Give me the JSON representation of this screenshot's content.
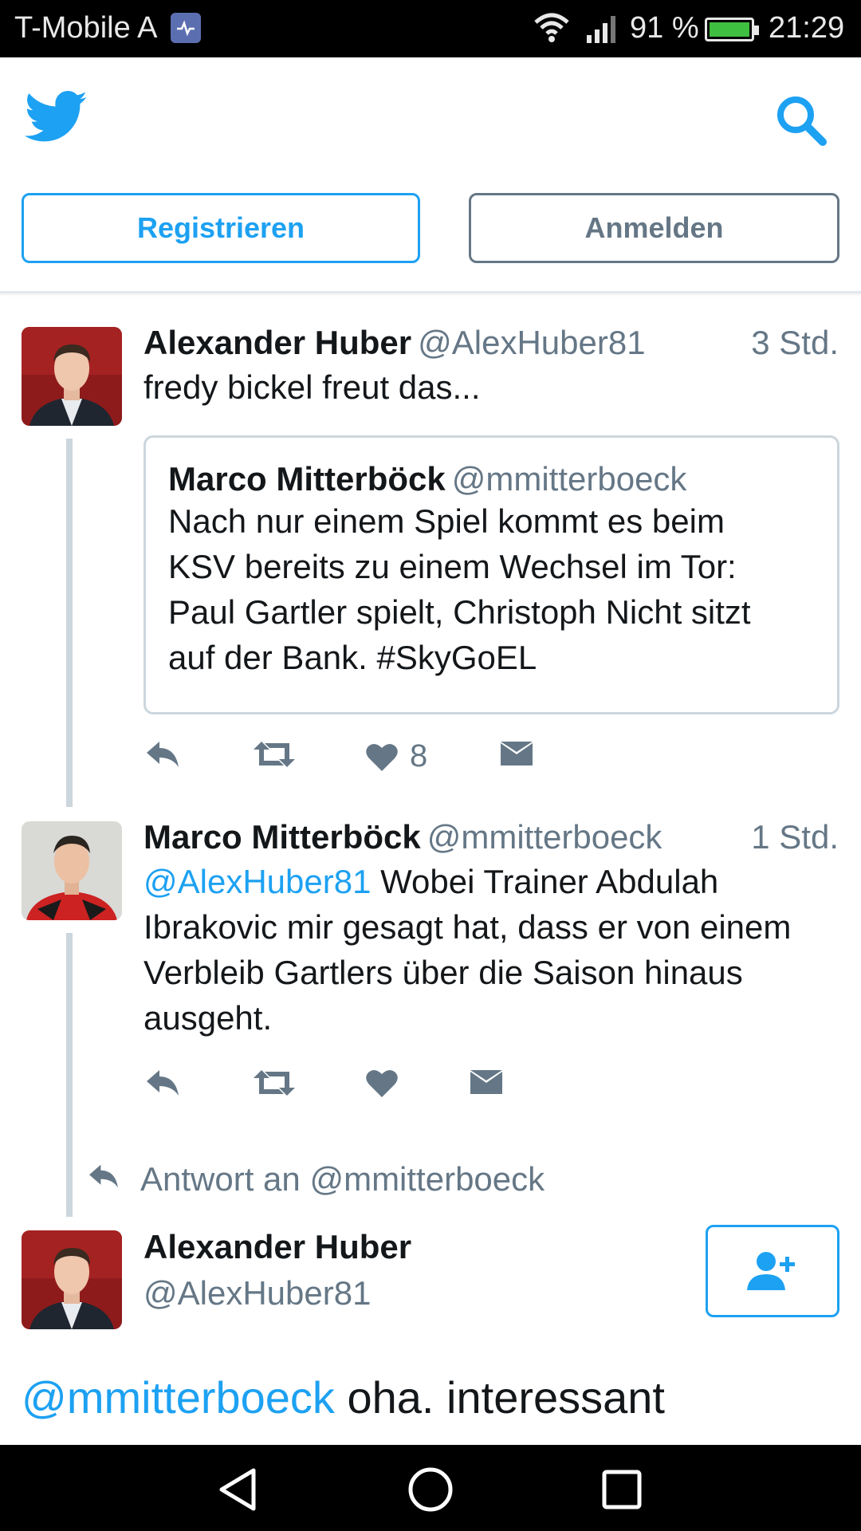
{
  "status_bar": {
    "carrier": "T-Mobile A",
    "battery_percent": "91 %",
    "time": "21:29"
  },
  "header": {
    "register_label": "Registrieren",
    "login_label": "Anmelden"
  },
  "tweets": [
    {
      "name": "Alexander Huber",
      "handle": "@AlexHuber81",
      "time": "3 Std.",
      "text": "fredy bickel freut das...",
      "quote": {
        "name": "Marco Mitterböck",
        "handle": "@mmitterboeck",
        "lines": [
          "Nach nur einem Spiel kommt es beim",
          "KSV bereits zu einem Wechsel im Tor:",
          "Paul Gartler spielt, Christoph Nicht sitzt",
          "auf der Bank. #SkyGoEL"
        ]
      },
      "like_count": "8"
    },
    {
      "name": "Marco Mitterböck",
      "handle": "@mmitterboeck",
      "time": "1 Std.",
      "mention": "@AlexHuber81",
      "lines": [
        " Wobei Trainer Abdulah",
        "Ibrakovic mir gesagt hat, dass er von einem",
        "Verbleib Gartlers über die Saison hinaus",
        "ausgeht."
      ]
    }
  ],
  "reply_context": "Antwort an @mmitterboeck",
  "main_tweet": {
    "name": "Alexander Huber",
    "handle": "@AlexHuber81",
    "mention": "@mmitterboeck",
    "text": " oha. interessant"
  },
  "colors": {
    "accent": "#1da1f2",
    "muted": "#657786",
    "thread_line": "#ccd6dd"
  }
}
